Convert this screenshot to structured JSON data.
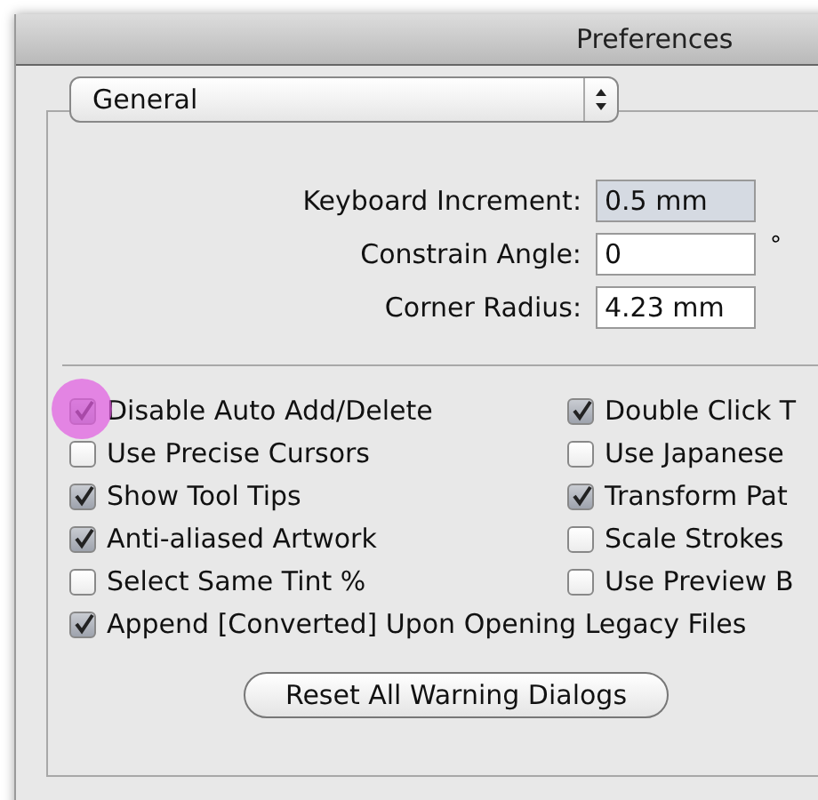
{
  "window": {
    "title": "Preferences"
  },
  "section_popup": {
    "value": "General"
  },
  "fields": [
    {
      "label": "Keyboard Increment:",
      "value": "0.5 mm",
      "disabled": true
    },
    {
      "label": "Constrain Angle:",
      "value": "0",
      "unit": "°",
      "disabled": false
    },
    {
      "label": "Corner Radius:",
      "value": "4.23 mm",
      "disabled": false
    }
  ],
  "options": [
    {
      "label": "Disable Auto Add/Delete",
      "checked": true,
      "highlighted": true
    },
    {
      "label": "Double Click T",
      "checked": true,
      "highlighted": false
    },
    {
      "label": "Use Precise Cursors",
      "checked": false,
      "highlighted": false
    },
    {
      "label": "Use Japanese",
      "checked": false,
      "highlighted": false
    },
    {
      "label": "Show Tool Tips",
      "checked": true,
      "highlighted": false
    },
    {
      "label": "Transform Pat",
      "checked": true,
      "highlighted": false
    },
    {
      "label": "Anti-aliased Artwork",
      "checked": true,
      "highlighted": false
    },
    {
      "label": "Scale Strokes",
      "checked": false,
      "highlighted": false
    },
    {
      "label": "Select Same Tint %",
      "checked": false,
      "highlighted": false
    },
    {
      "label": "Use Preview B",
      "checked": false,
      "highlighted": false
    }
  ],
  "wide_option": {
    "label": "Append [Converted] Upon Opening Legacy Files",
    "checked": true
  },
  "reset_button": "Reset All Warning Dialogs"
}
